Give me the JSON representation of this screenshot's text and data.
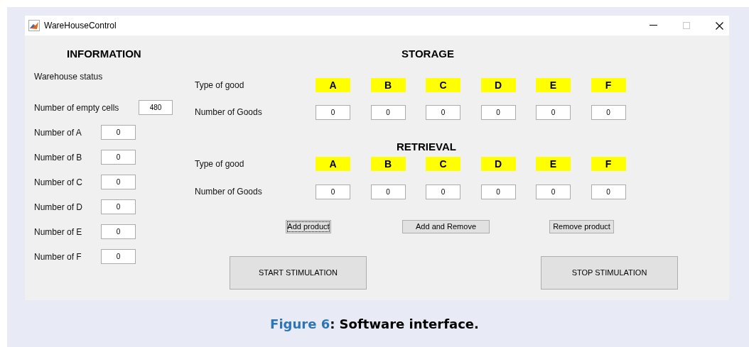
{
  "window": {
    "title": "WareHouseControl"
  },
  "information": {
    "heading": "INFORMATION",
    "status_label": "Warehouse status",
    "fields": [
      {
        "label": "Number of empty cells",
        "value": "480"
      },
      {
        "label": "Number of A",
        "value": "0"
      },
      {
        "label": "Number of B",
        "value": "0"
      },
      {
        "label": "Number of C",
        "value": "0"
      },
      {
        "label": "Number of D",
        "value": "0"
      },
      {
        "label": "Number of E",
        "value": "0"
      },
      {
        "label": "Number of F",
        "value": "0"
      }
    ]
  },
  "storage": {
    "heading": "STORAGE",
    "type_label": "Type of good",
    "goods_label": "Number of Goods",
    "types": [
      "A",
      "B",
      "C",
      "D",
      "E",
      "F"
    ],
    "counts": [
      "0",
      "0",
      "0",
      "0",
      "0",
      "0"
    ]
  },
  "retrieval": {
    "heading": "RETRIEVAL",
    "type_label": "Type of good",
    "goods_label": "Number of Goods",
    "types": [
      "A",
      "B",
      "C",
      "D",
      "E",
      "F"
    ],
    "counts": [
      "0",
      "0",
      "0",
      "0",
      "0",
      "0"
    ]
  },
  "actions": [
    {
      "label": "Add product",
      "focused": true
    },
    {
      "label": "Add and Remove",
      "focused": false
    },
    {
      "label": "Remove product",
      "focused": false
    }
  ],
  "simulation": [
    {
      "label": "START STIMULATION"
    },
    {
      "label": "STOP STIMULATION"
    }
  ],
  "caption": {
    "label": "Figure 6",
    "text": ": Software interface."
  }
}
